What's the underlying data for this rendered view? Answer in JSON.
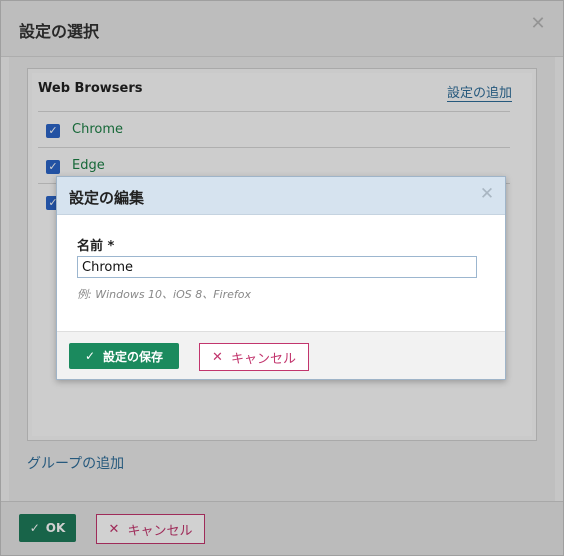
{
  "outer_dialog": {
    "title": "設定の選択",
    "section_title": "Web Browsers",
    "add_setting_label": "設定の追加",
    "items": [
      {
        "label": "Chrome",
        "checked": true
      },
      {
        "label": "Edge",
        "checked": true
      },
      {
        "label": "",
        "checked": true
      }
    ],
    "add_group_label": "グループの追加",
    "ok_label": "OK",
    "cancel_label": "キャンセル"
  },
  "edit_modal": {
    "title": "設定の編集",
    "field_label": "名前 *",
    "field_value": "Chrome",
    "field_hint": "例: Windows 10、iOS 8、Firefox",
    "save_label": "設定の保存",
    "cancel_label": "キャンセル"
  },
  "icons": {
    "close": "close-icon",
    "check": "check-icon",
    "x": "x-icon"
  },
  "colors": {
    "primary_green": "#1b8a5e",
    "danger": "#c2356d",
    "link_blue": "#2f6d99",
    "modal_header": "#d6e3ef"
  }
}
